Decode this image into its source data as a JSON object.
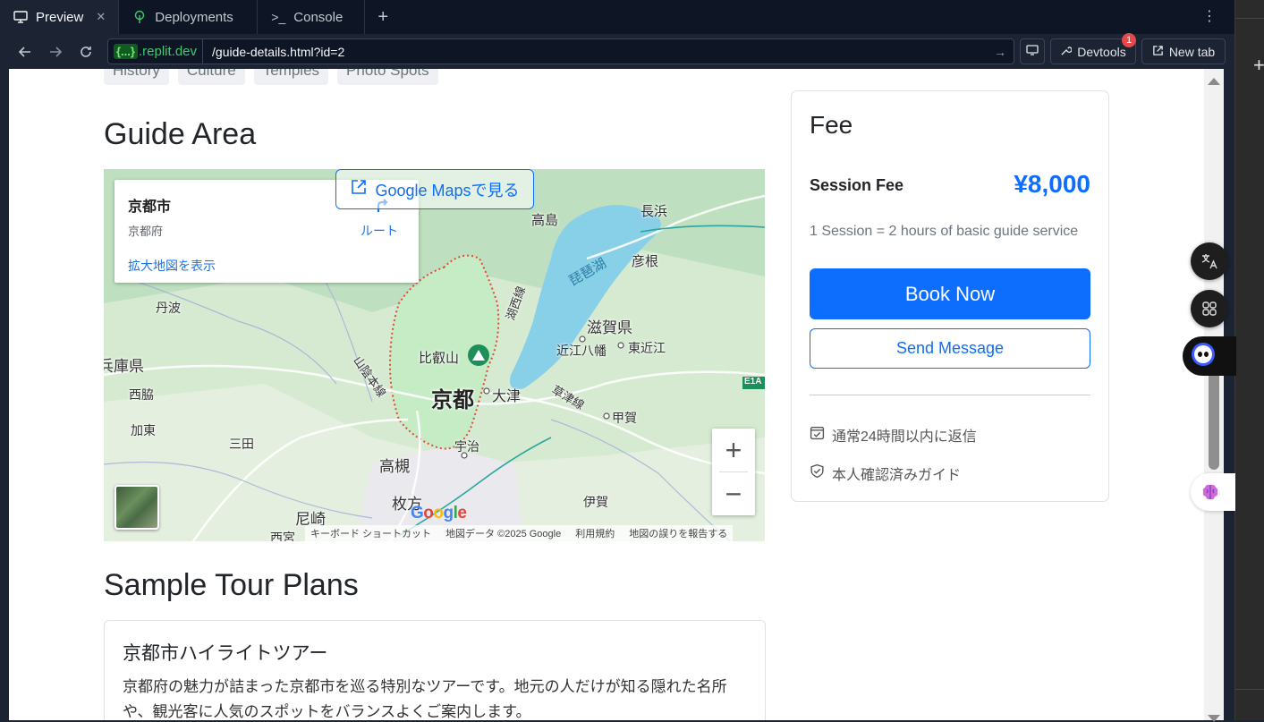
{
  "tabs": [
    {
      "label": "Preview",
      "icon": "monitor-icon"
    },
    {
      "label": "Deployments",
      "icon": "tree-icon"
    },
    {
      "label": "Console",
      "icon": "terminal-icon"
    }
  ],
  "urlbar": {
    "domain_chip": "{...}",
    "domain": ".replit.dev",
    "path": "/guide-details.html?id=2",
    "devtools_label": "Devtools",
    "devtools_badge": "1",
    "new_tab_label": "New tab"
  },
  "page": {
    "tags": [
      "History",
      "Culture",
      "Temples",
      "Photo Spots"
    ],
    "guide_area_title": "Guide Area",
    "map": {
      "place_title": "京都市",
      "place_region": "京都府",
      "route_label": "ルート",
      "larger_map_link": "拡大地図を表示",
      "open_gmaps_label": "Google Mapsで見る",
      "attribution": [
        "キーボード ショートカット",
        "地図データ ©2025 Google",
        "利用規約",
        "地図の誤りを報告する"
      ],
      "labels": {
        "kyoto": "京都",
        "otsu": "大津",
        "shiga": "滋賀県",
        "biwako": "琵琶湖",
        "takashima": "高島",
        "nagahama": "長浜",
        "hikone": "彦根",
        "omihachiman": "近江八幡",
        "higashiomi": "東近江",
        "koka": "甲賀",
        "uji": "宇治",
        "takatsuki": "高槻",
        "hirakata": "枚方",
        "amagasaki": "尼崎",
        "nishinomiya": "西宮",
        "sanda": "三田",
        "kasai": "加東",
        "nishiwaki": "西脇",
        "hyogo": "兵庫県",
        "tanba": "丹波",
        "hieizan": "比叡山",
        "sanin": "山陰本線",
        "kosei": "湖西線",
        "kusatsu": "草津線",
        "iga": "伊賀",
        "e1a": "E1A"
      }
    },
    "tour_title": "Sample Tour Plans",
    "tour": {
      "title": "京都市ハイライトツアー",
      "description": "京都府の魅力が詰まった京都市を巡る特別なツアーです。地元の人だけが知る隠れた名所や、観光客に人気のスポットをバランスよくご案内します。"
    },
    "fee": {
      "title": "Fee",
      "session_label": "Session Fee",
      "price": "¥8,000",
      "note": "1 Session = 2 hours of basic guide service",
      "book_label": "Book Now",
      "message_label": "Send Message",
      "reply_note": "通常24時間以内に返信",
      "verified_note": "本人確認済みガイド"
    }
  },
  "colors": {
    "primary": "#0d6efd",
    "chrome_bg": "#0e1525",
    "replit_green": "#3ccc6b"
  }
}
